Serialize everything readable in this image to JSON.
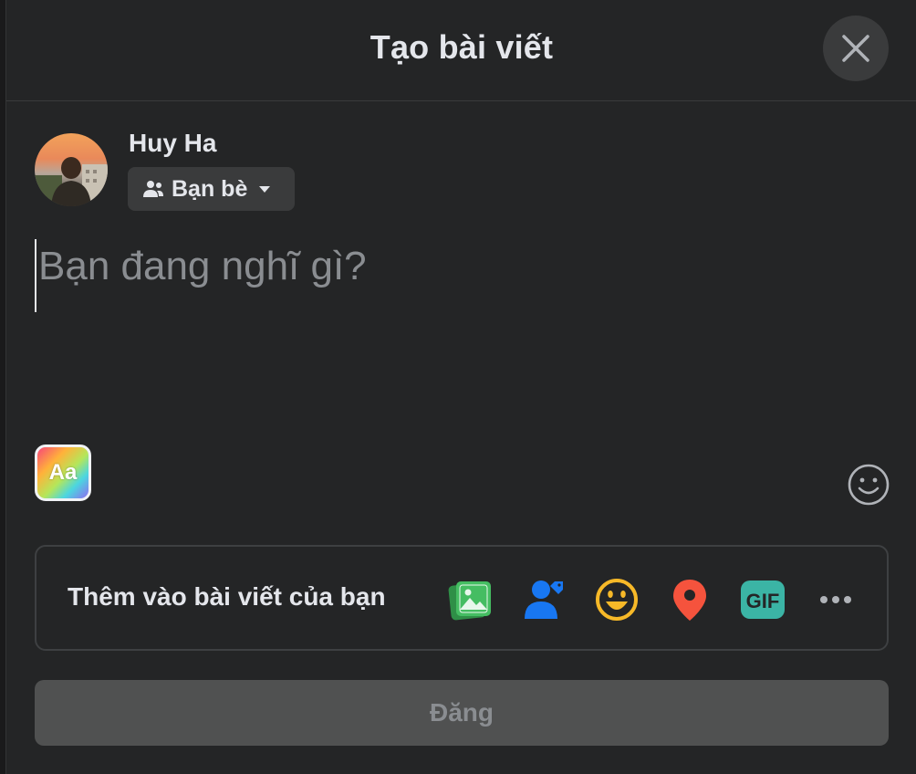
{
  "header": {
    "title": "Tạo bài viết"
  },
  "user": {
    "name": "Huy Ha",
    "audience": "Bạn bè"
  },
  "composer": {
    "placeholder": "Bạn đang nghĩ gì?"
  },
  "text_format": {
    "label": "Aa"
  },
  "add_to_post": {
    "label": "Thêm vào bài viết của bạn",
    "tools": [
      {
        "name": "photo-video-icon",
        "color": "#45bd62"
      },
      {
        "name": "tag-people-icon",
        "color": "#1877f2"
      },
      {
        "name": "feeling-icon",
        "color": "#f7b928"
      },
      {
        "name": "check-in-icon",
        "color": "#f5533d"
      },
      {
        "name": "gif-icon",
        "color": "#3bb4a5",
        "label": "GIF"
      },
      {
        "name": "more-icon",
        "color": "#b0b3b8"
      }
    ]
  },
  "post_button": {
    "label": "Đăng"
  },
  "colors": {
    "background": "#242526",
    "surface": "#3a3b3c",
    "text": "#e4e6eb",
    "muted": "#8a8d91"
  }
}
